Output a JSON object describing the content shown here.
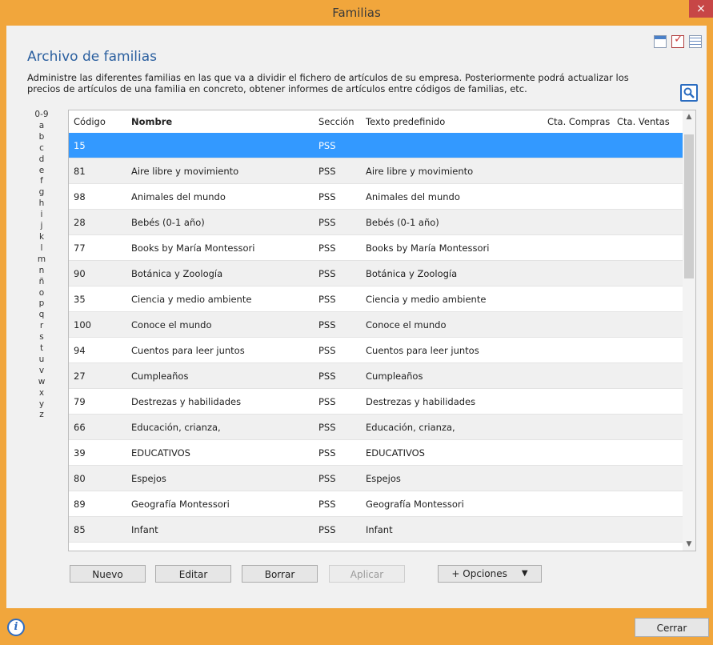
{
  "window": {
    "title": "Familias",
    "close_glyph": "×"
  },
  "header": {
    "title": "Archivo de familias",
    "description": "Administre las diferentes familias en las que va a dividir el fichero de artículos de su empresa. Posteriormente podrá actualizar los precios de artículos de una familia en concreto, obtener informes de artículos entre códigos de familias, etc."
  },
  "alphabet": [
    "0-9",
    "a",
    "b",
    "c",
    "d",
    "e",
    "f",
    "g",
    "h",
    "i",
    "j",
    "k",
    "l",
    "m",
    "n",
    "ñ",
    "o",
    "p",
    "q",
    "r",
    "s",
    "t",
    "u",
    "v",
    "w",
    "x",
    "y",
    "z"
  ],
  "table": {
    "columns": [
      "Código",
      "Nombre",
      "Sección",
      "Texto predefinido",
      "Cta. Compras",
      "Cta. Ventas"
    ],
    "rows": [
      [
        "15",
        "",
        "PSS",
        "",
        "",
        ""
      ],
      [
        "81",
        "Aire libre y movimiento",
        "PSS",
        "Aire libre y movimiento",
        "",
        ""
      ],
      [
        "98",
        "Animales del mundo",
        "PSS",
        "Animales del mundo",
        "",
        ""
      ],
      [
        "28",
        "Bebés (0-1 año)",
        "PSS",
        "Bebés (0-1 año)",
        "",
        ""
      ],
      [
        "77",
        "Books by María Montessori",
        "PSS",
        "Books by María Montessori",
        "",
        ""
      ],
      [
        "90",
        "Botánica y Zoología",
        "PSS",
        "Botánica y Zoología",
        "",
        ""
      ],
      [
        "35",
        "Ciencia y medio ambiente",
        "PSS",
        "Ciencia y medio ambiente",
        "",
        ""
      ],
      [
        "100",
        "Conoce el mundo",
        "PSS",
        "Conoce el mundo",
        "",
        ""
      ],
      [
        "94",
        "Cuentos para leer juntos",
        "PSS",
        "Cuentos para leer juntos",
        "",
        ""
      ],
      [
        "27",
        "Cumpleaños",
        "PSS",
        "Cumpleaños",
        "",
        ""
      ],
      [
        "79",
        "Destrezas y habilidades",
        "PSS",
        "Destrezas y habilidades",
        "",
        ""
      ],
      [
        "66",
        "Educación, crianza,",
        "PSS",
        "Educación, crianza,",
        "",
        ""
      ],
      [
        "39",
        "EDUCATIVOS",
        "PSS",
        "EDUCATIVOS",
        "",
        ""
      ],
      [
        "80",
        "Espejos",
        "PSS",
        "Espejos",
        "",
        ""
      ],
      [
        "89",
        "Geografía Montessori",
        "PSS",
        "Geografía Montessori",
        "",
        ""
      ],
      [
        "85",
        "Infant",
        "PSS",
        "Infant",
        "",
        ""
      ]
    ],
    "selected_row": 0
  },
  "buttons": {
    "nuevo": "Nuevo",
    "editar": "Editar",
    "borrar": "Borrar",
    "aplicar": "Aplicar",
    "opciones": "+ Opciones",
    "cerrar": "Cerrar"
  },
  "icons": [
    "calendar-icon",
    "checklist-icon",
    "grid-icon",
    "search-icon",
    "info-icon",
    "dropdown-arrow-icon"
  ],
  "colors": {
    "accent": "#f1a63c",
    "selection": "#3399ff",
    "title_blue": "#2a5f9f"
  }
}
